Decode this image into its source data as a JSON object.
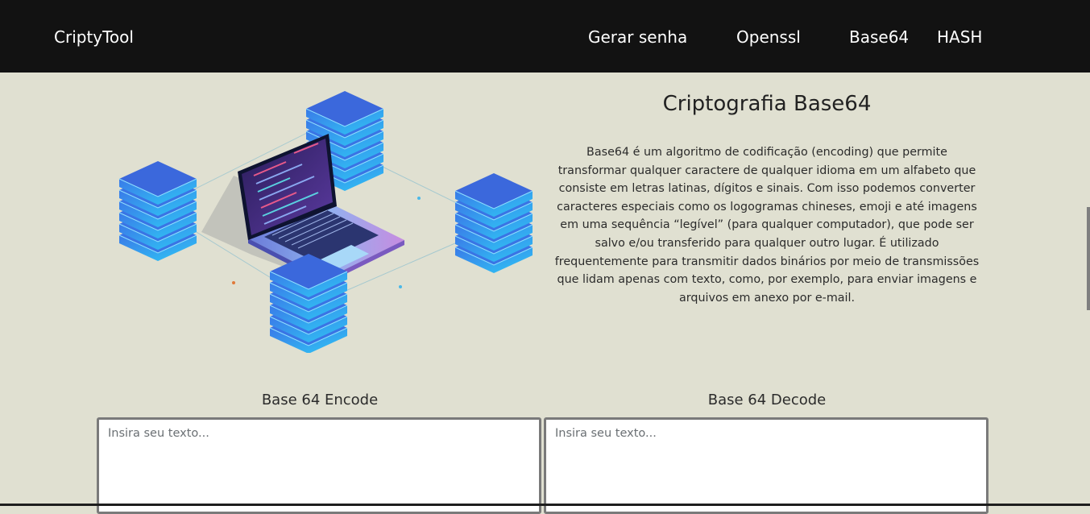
{
  "navbar": {
    "brand": "CriptyTool",
    "links": [
      "Gerar senha",
      "Openssl",
      "Base64",
      "HASH"
    ]
  },
  "hero": {
    "title": "Criptografia Base64",
    "description_lines": [
      "Base64 é um algoritmo de codificação (encoding) que permite",
      "transformar qualquer caractere de qualquer idioma em um alfabeto que",
      "consiste em letras latinas, dígitos e sinais. Com isso podemos converter",
      "caracteres especiais como os logogramas chineses, emoji e até imagens",
      "em uma sequência “legível” (para qualquer computador), que pode ser",
      "salvo e/ou transferido para qualquer outro lugar. É utilizado",
      "frequentemente para transmitir dados binários por meio de transmissões",
      "que lidam apenas com texto, como, por exemplo, para enviar imagens e",
      "arquivos em anexo por e-mail."
    ],
    "illustration_icon": "laptop-servers-illustration"
  },
  "encode": {
    "label": "Base 64 Encode",
    "placeholder": "Insira seu texto...",
    "value": ""
  },
  "decode": {
    "label": "Base 64 Decode",
    "placeholder": "Insira seu texto...",
    "value": ""
  },
  "colors": {
    "navbar_bg": "#121212",
    "page_bg": "#e0e0d1",
    "server_top": "#3b6ee0",
    "server_side": "#2fa8f0"
  }
}
